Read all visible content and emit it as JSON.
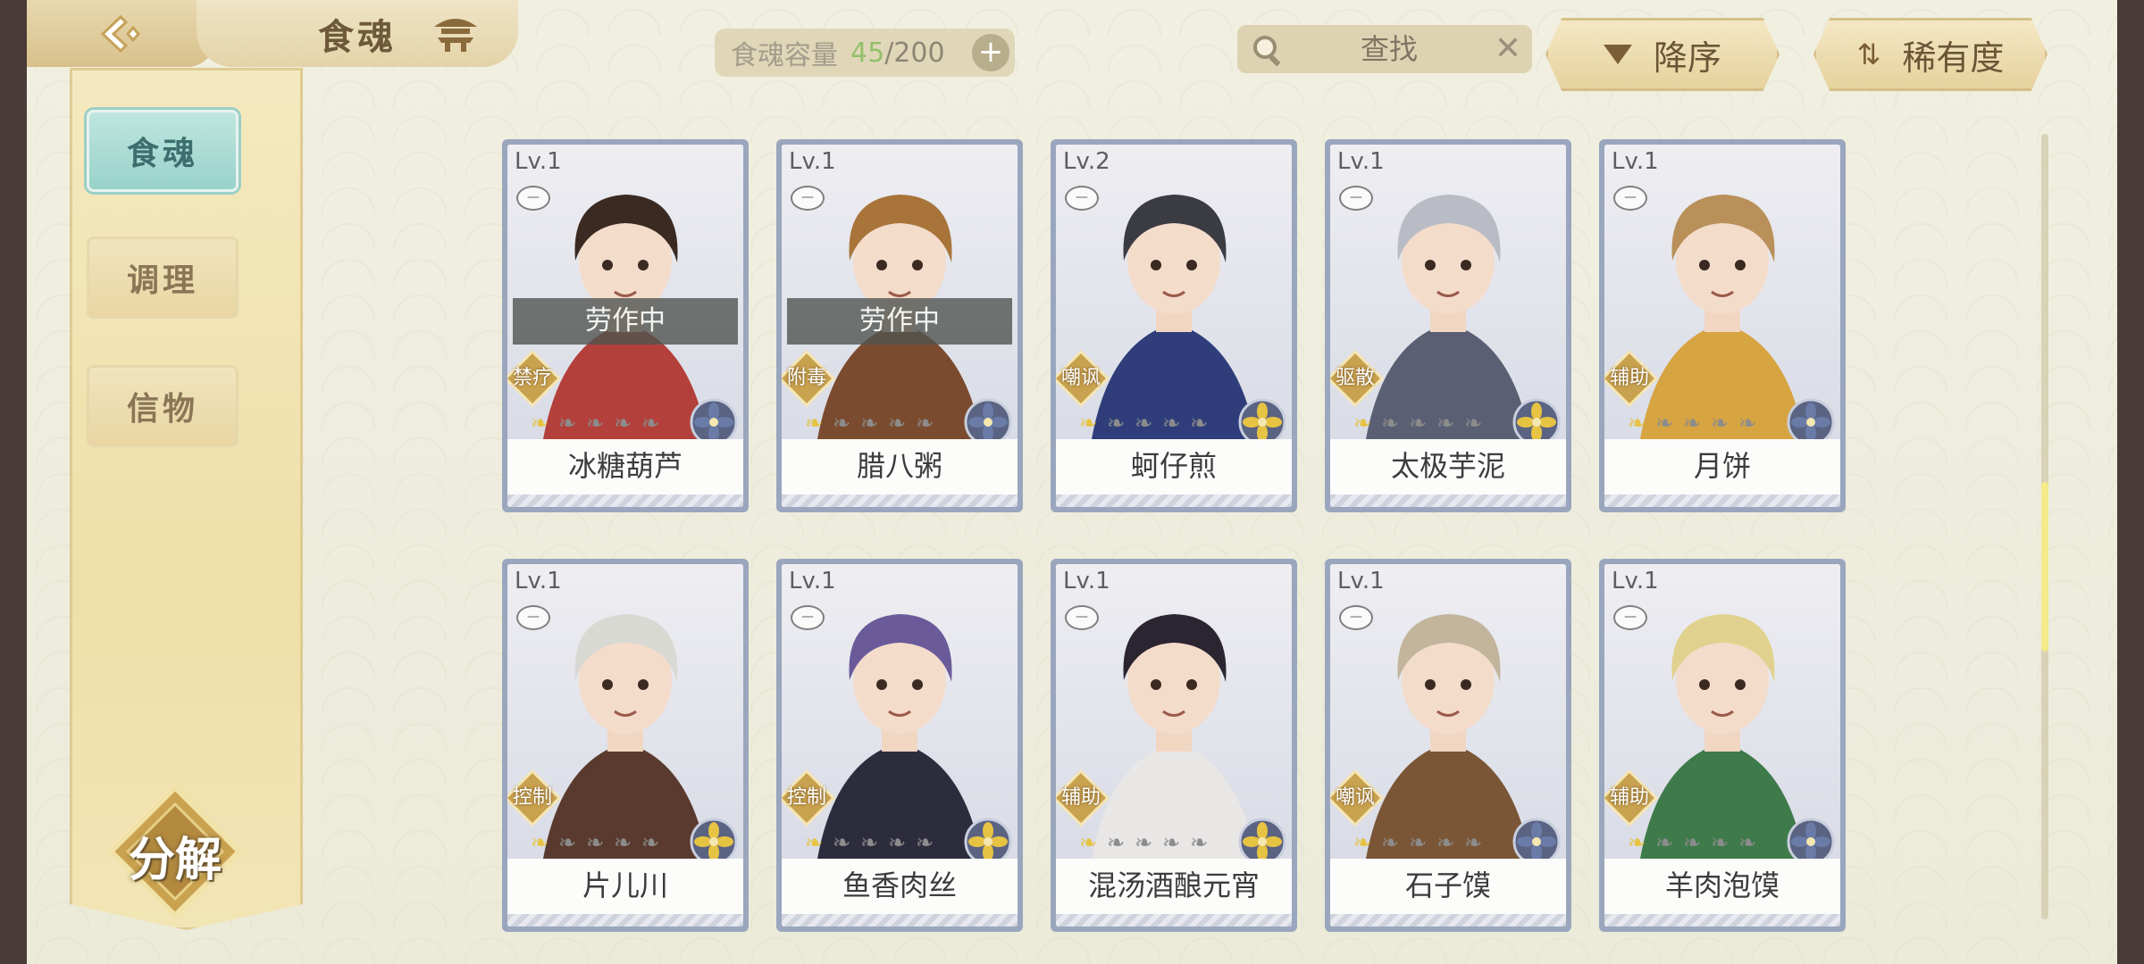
{
  "header": {
    "title": "食魂",
    "capacity_label": "食魂容量",
    "capacity_current": "45",
    "capacity_max": "/200",
    "search_placeholder": "查找",
    "sort_label": "降序",
    "rarity_label": "稀有度"
  },
  "sidebar": {
    "items": [
      {
        "label": "食魂",
        "active": true
      },
      {
        "label": "调理",
        "active": false
      },
      {
        "label": "信物",
        "active": false
      }
    ],
    "decompose_label": "分解"
  },
  "cards": [
    {
      "level": "Lv.1",
      "name": "冰糖葫芦",
      "role": "禁疗",
      "status": "劳作中",
      "stars_on": 1,
      "palette": "#b3403b",
      "hair": "#3a2a22",
      "element": "blue"
    },
    {
      "level": "Lv.1",
      "name": "腊八粥",
      "role": "附毒",
      "status": "劳作中",
      "stars_on": 1,
      "palette": "#7a4b2e",
      "hair": "#a8743a",
      "element": "blue"
    },
    {
      "level": "Lv.2",
      "name": "蚵仔煎",
      "role": "嘲讽",
      "status": "",
      "stars_on": 1,
      "palette": "#2f3e7a",
      "hair": "#3b3b42",
      "element": "gold"
    },
    {
      "level": "Lv.1",
      "name": "太极芋泥",
      "role": "驱散",
      "status": "",
      "stars_on": 1,
      "palette": "#5a5f73",
      "hair": "#b9bcc4",
      "element": "gold"
    },
    {
      "level": "Lv.1",
      "name": "月饼",
      "role": "辅助",
      "status": "",
      "stars_on": 1,
      "palette": "#d7a442",
      "hair": "#b9905a",
      "element": "blue"
    },
    {
      "level": "Lv.1",
      "name": "片儿川",
      "role": "控制",
      "status": "",
      "stars_on": 1,
      "palette": "#5a3a2e",
      "hair": "#d9d9d4",
      "element": "gold"
    },
    {
      "level": "Lv.1",
      "name": "鱼香肉丝",
      "role": "控制",
      "status": "",
      "stars_on": 1,
      "palette": "#2d2c3d",
      "hair": "#6a5a9a",
      "element": "gold"
    },
    {
      "level": "Lv.1",
      "name": "混汤酒酿元宵",
      "role": "辅助",
      "status": "",
      "stars_on": 1,
      "palette": "#e9e6e6",
      "hair": "#2a2530",
      "element": "gold"
    },
    {
      "level": "Lv.1",
      "name": "石子馍",
      "role": "嘲讽",
      "status": "",
      "stars_on": 1,
      "palette": "#7a5636",
      "hair": "#c2b59c",
      "element": "blue"
    },
    {
      "level": "Lv.1",
      "name": "羊肉泡馍",
      "role": "辅助",
      "status": "",
      "stars_on": 1,
      "palette": "#3e7a4a",
      "hair": "#e0d28e",
      "element": "blue"
    }
  ],
  "colors": {
    "accent_teal": "#98d2c9",
    "gold": "#e7c343",
    "capacity_green": "#93c06a"
  }
}
